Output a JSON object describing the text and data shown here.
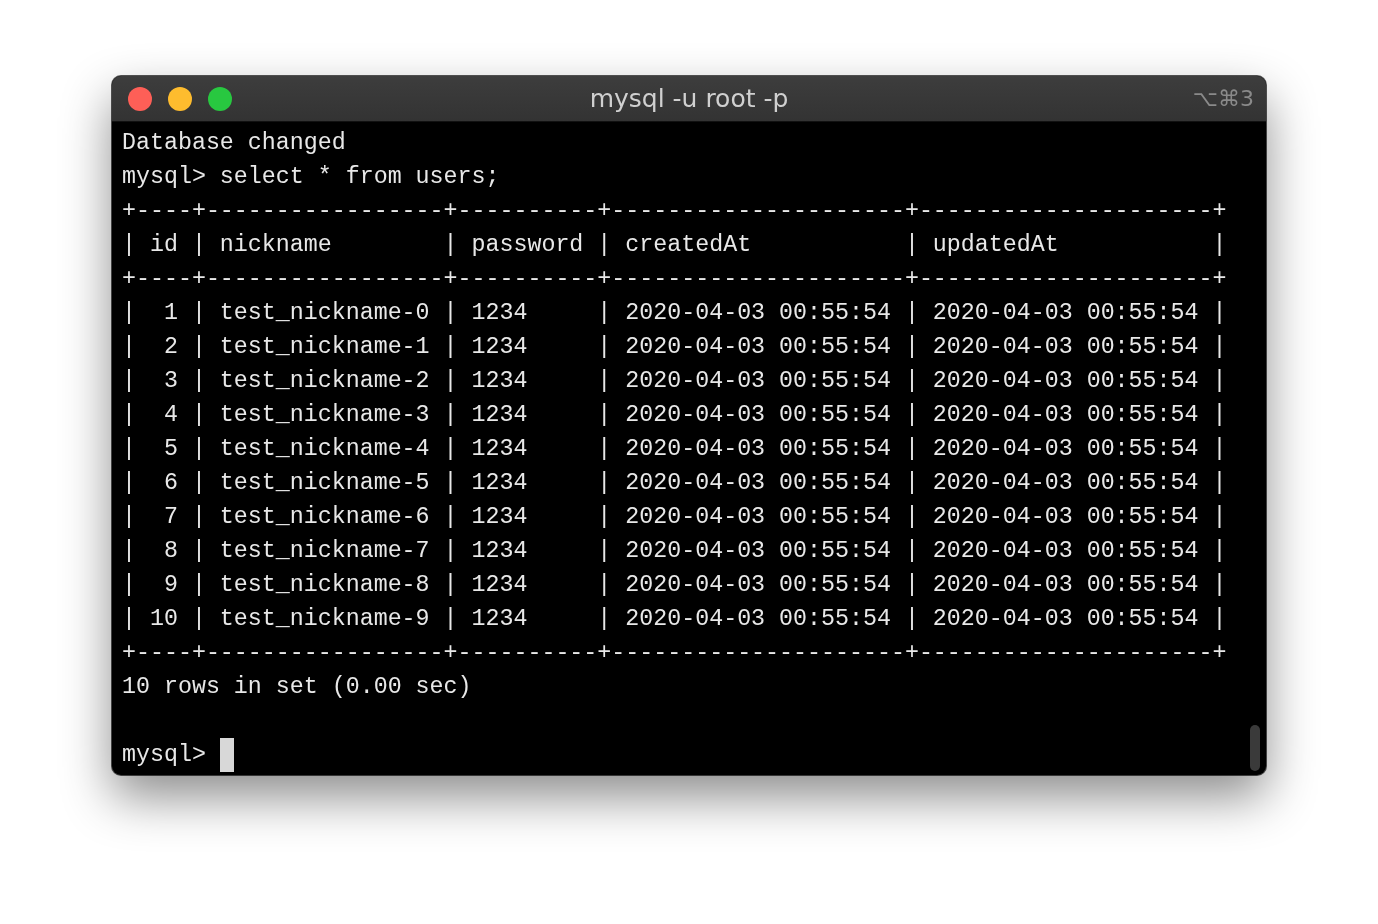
{
  "window": {
    "title": "mysql -u root -p",
    "shortcut": "⌥⌘3"
  },
  "lines": [
    "Database changed",
    "mysql> select * from users;",
    "+----+-----------------+----------+---------------------+---------------------+",
    "| id | nickname        | password | createdAt           | updatedAt           |",
    "+----+-----------------+----------+---------------------+---------------------+",
    "|  1 | test_nickname-0 | 1234     | 2020-04-03 00:55:54 | 2020-04-03 00:55:54 |",
    "|  2 | test_nickname-1 | 1234     | 2020-04-03 00:55:54 | 2020-04-03 00:55:54 |",
    "|  3 | test_nickname-2 | 1234     | 2020-04-03 00:55:54 | 2020-04-03 00:55:54 |",
    "|  4 | test_nickname-3 | 1234     | 2020-04-03 00:55:54 | 2020-04-03 00:55:54 |",
    "|  5 | test_nickname-4 | 1234     | 2020-04-03 00:55:54 | 2020-04-03 00:55:54 |",
    "|  6 | test_nickname-5 | 1234     | 2020-04-03 00:55:54 | 2020-04-03 00:55:54 |",
    "|  7 | test_nickname-6 | 1234     | 2020-04-03 00:55:54 | 2020-04-03 00:55:54 |",
    "|  8 | test_nickname-7 | 1234     | 2020-04-03 00:55:54 | 2020-04-03 00:55:54 |",
    "|  9 | test_nickname-8 | 1234     | 2020-04-03 00:55:54 | 2020-04-03 00:55:54 |",
    "| 10 | test_nickname-9 | 1234     | 2020-04-03 00:55:54 | 2020-04-03 00:55:54 |",
    "+----+-----------------+----------+---------------------+---------------------+",
    "10 rows in set (0.00 sec)"
  ],
  "prompt": "mysql>"
}
